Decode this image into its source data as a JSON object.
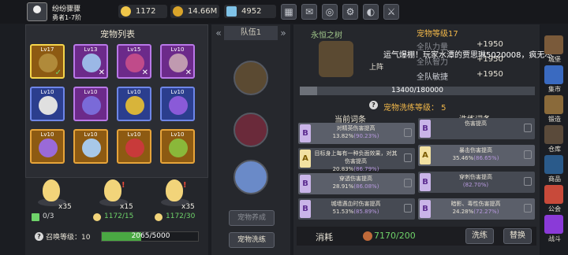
{
  "player": {
    "name": "纷纷骤骤",
    "rank": "勇者1-7阶"
  },
  "resources": [
    {
      "name": "gold",
      "value": "1172",
      "color": "#f0c64a"
    },
    {
      "name": "coins",
      "value": "14.66",
      "suffix": "M",
      "color": "#d9a42a"
    },
    {
      "name": "gems",
      "value": "4952",
      "color": "#7fc3e8"
    }
  ],
  "top_icons": [
    "cart-icon",
    "mail-icon",
    "gamepad-icon",
    "gear-icon",
    "color-wheel-icon",
    "sword-icon"
  ],
  "pet_list": {
    "title": "宠物列表",
    "pets": [
      {
        "level": "Lv17",
        "rarity": "gold",
        "selected": true,
        "mark": "✓",
        "color": "#b08a3a"
      },
      {
        "level": "Lv13",
        "rarity": "purple",
        "mark": "✕",
        "color": "#9bb8e6"
      },
      {
        "level": "Lv15",
        "rarity": "purple",
        "mark": "✕",
        "color": "#c04b8a"
      },
      {
        "level": "Lv10",
        "rarity": "purple",
        "mark": "✕",
        "color": "#c09ab0"
      },
      {
        "level": "Lv10",
        "rarity": "blue",
        "mark": "",
        "color": "#e0e0e0"
      },
      {
        "level": "Lv10",
        "rarity": "purple",
        "mark": "",
        "color": "#7a6ad8"
      },
      {
        "level": "Lv10",
        "rarity": "blue",
        "mark": "",
        "color": "#d8b43a"
      },
      {
        "level": "Lv10",
        "rarity": "blue",
        "mark": "",
        "color": "#8a5ad8"
      },
      {
        "level": "Lv10",
        "rarity": "gold",
        "mark": "",
        "color": "#9a6ad8"
      },
      {
        "level": "Lv10",
        "rarity": "gold",
        "mark": "",
        "color": "#a8c8e8"
      },
      {
        "level": "Lv10",
        "rarity": "gold",
        "mark": "",
        "color": "#c83a3a"
      },
      {
        "level": "Lv10",
        "rarity": "gold",
        "mark": "",
        "color": "#8ab83a"
      }
    ]
  },
  "eggs": [
    {
      "count": "x35",
      "owned": "0/3",
      "res_color": "#d8d8d8"
    },
    {
      "count": "x15",
      "owned": "1172/15",
      "res_color": "#6fd36a"
    },
    {
      "count": "x35",
      "owned": "1172/30",
      "res_color": "#6fd36a"
    }
  ],
  "summon": {
    "label": "召唤等级：",
    "level": "10",
    "progress": "2065/5000",
    "fraction": 0.413
  },
  "team": {
    "label": "队伍1",
    "pet_button": "宠物养成",
    "wash_button": "宠物洗练"
  },
  "pet_detail": {
    "name": "永恒之树",
    "level_label": "宠物等级17",
    "deploy_label": "上阵",
    "stats": [
      {
        "name": "全队力量",
        "value": "+1950"
      },
      {
        "name": "全队智力",
        "value": "+1950"
      },
      {
        "name": "全队敏捷",
        "value": "+1950"
      }
    ],
    "exp": "13400/180000",
    "exp_fraction": 0.074,
    "wash_level": "宠物洗练等级：  5"
  },
  "entries": {
    "current_header": "当前词条",
    "wash_header": "洗练词条",
    "current": [
      {
        "grade": "B",
        "text": "对精英伤害提高",
        "pct": "13.82%",
        "range": "(90.23%)"
      },
      {
        "grade": "A",
        "text": "目标身上每有一种负面效果，对其伤害提高",
        "pct": "20.83%",
        "range": "(86.79%)"
      },
      {
        "grade": "B",
        "text": "穿透伤害提高",
        "pct": "28.91%",
        "range": "(86.08%)"
      },
      {
        "grade": "B",
        "text": "城墙遇血时伤害提高",
        "pct": "51.53%",
        "range": "(85.89%)"
      }
    ],
    "wash": [
      {
        "grade": "B",
        "text": "伤害提高",
        "pct": "",
        "range": ""
      },
      {
        "grade": "A",
        "text": "暴击伤害提高",
        "pct": "35.46%",
        "range": "(86.65%)"
      },
      {
        "grade": "B",
        "text": "穿刺伤害提高",
        "pct": "",
        "range": "(82.70%)"
      },
      {
        "grade": "B",
        "text": "暗影、毒性伤害提高",
        "pct": "24.28%",
        "range": "(72.27%)"
      }
    ]
  },
  "consume": {
    "label": "消耗",
    "value": "7170/200"
  },
  "actions": {
    "wash": "洗练",
    "replace": "替换"
  },
  "right_menu": [
    {
      "label": "城堡",
      "color": "#7a5a3a"
    },
    {
      "label": "集市",
      "color": "#3a6ac0"
    },
    {
      "label": "锻造",
      "color": "#8a6a3a"
    },
    {
      "label": "仓库",
      "color": "#5a4a3a"
    },
    {
      "label": "商品",
      "color": "#2a5a8a"
    },
    {
      "label": "公会",
      "color": "#c84a3a"
    },
    {
      "label": "战斗",
      "color": "#8a3ad8"
    }
  ],
  "overlay_text": "运气爆棚！玩家水潭的贾思琳5020008，疯无尽",
  "colors": {
    "gold": "#f2b84a",
    "green": "#4aa843",
    "purple": "#b978e8"
  }
}
